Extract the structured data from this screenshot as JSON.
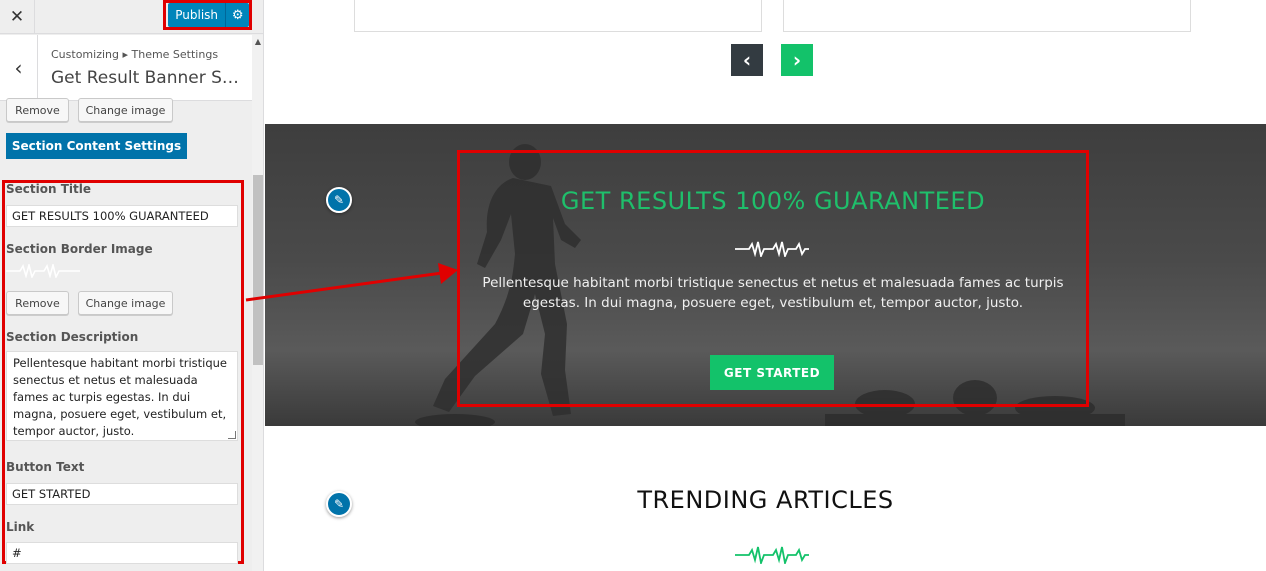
{
  "customizer": {
    "close_label": "✕",
    "publish_label": "Publish",
    "gear_icon": "⚙",
    "back_icon": "‹",
    "breadcrumb": "Customizing ▸ Theme Settings",
    "panel_title": "Get Result Banner Settings"
  },
  "background_image": {
    "remove_label": "Remove",
    "change_label": "Change image"
  },
  "section_content_button": "Section Content Settings",
  "fields": {
    "section_title_label": "Section Title",
    "section_title_value": "GET RESULTS 100% GUARANTEED",
    "border_image_label": "Section Border Image",
    "remove_label": "Remove",
    "change_label": "Change image",
    "description_label": "Section Description",
    "description_value": "Pellentesque habitant morbi tristique senectus et netus et malesuada fames ac turpis egestas. In dui magna, posuere eget, vestibulum et, tempor auctor, justo.",
    "button_text_label": "Button Text",
    "button_text_value": "GET STARTED",
    "link_label": "Link",
    "link_value": "#"
  },
  "preview": {
    "prev_arrow": "‹",
    "next_arrow": "›",
    "banner": {
      "title": "GET RESULTS 100% GUARANTEED",
      "description": "Pellentesque habitant morbi tristique senectus et netus et malesuada fames ac turpis egestas. In dui magna, posuere eget, vestibulum et, tempor auctor, justo.",
      "cta_label": "GET STARTED"
    },
    "trending_title": "TRENDING ARTICLES",
    "pencil_icon": "✎"
  },
  "colors": {
    "accent_green": "#13c26a",
    "title_green": "#1fbf6b",
    "wp_blue": "#0085ba",
    "annotation_red": "#e00000",
    "dark_nav": "#333b41"
  }
}
